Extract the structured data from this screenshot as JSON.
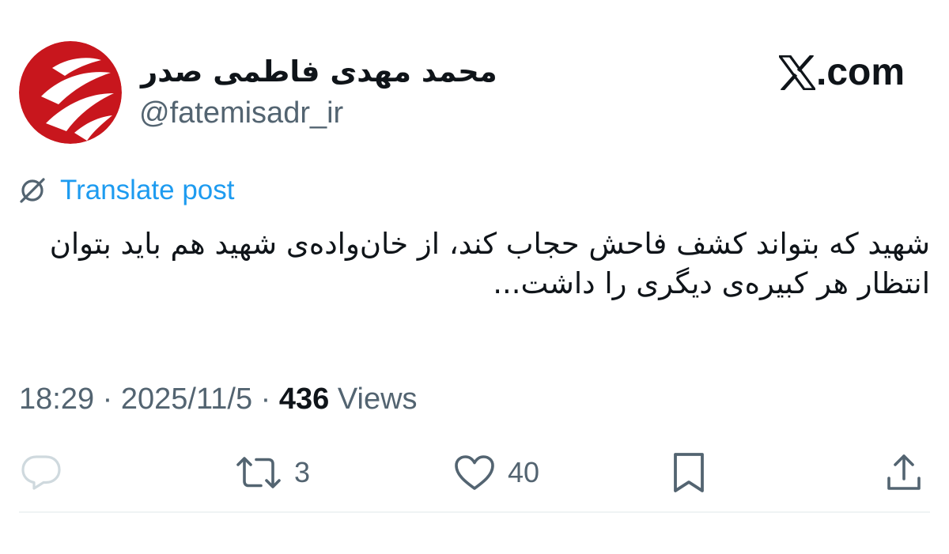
{
  "profile": {
    "display_name": "محمد مهدی فاطمی صدر",
    "handle": "@fatemisadr_ir",
    "avatar_icon": "tasnim-logo-icon",
    "avatar_color": "#c8161d"
  },
  "brand": {
    "logo_icon": "x-logo-icon",
    "logo_text": ".com"
  },
  "translate": {
    "icon": "globe-translate-icon",
    "label": "Translate post",
    "color": "#1d9bf0"
  },
  "post": {
    "text": "شهید که بتواند کشف فاحش حجاب کند، از خان‌واده‌ی شهید هم باید بتوان انتظار هر کبیره‌ی دیگری را داشت..."
  },
  "meta": {
    "time": "18:29",
    "separator": " · ",
    "date": "2025/11/5",
    "views_count": "436",
    "views_label": " Views"
  },
  "actions": {
    "reply": {
      "icon": "reply-icon",
      "count": ""
    },
    "repost": {
      "icon": "repost-icon",
      "count": "3"
    },
    "like": {
      "icon": "heart-icon",
      "count": "40"
    },
    "bookmark": {
      "icon": "bookmark-icon",
      "count": ""
    },
    "share": {
      "icon": "share-icon",
      "count": ""
    }
  },
  "colors": {
    "text": "#0f1419",
    "secondary": "#536471",
    "reply_icon": "#cfd9de",
    "divider": "#eff3f4"
  }
}
